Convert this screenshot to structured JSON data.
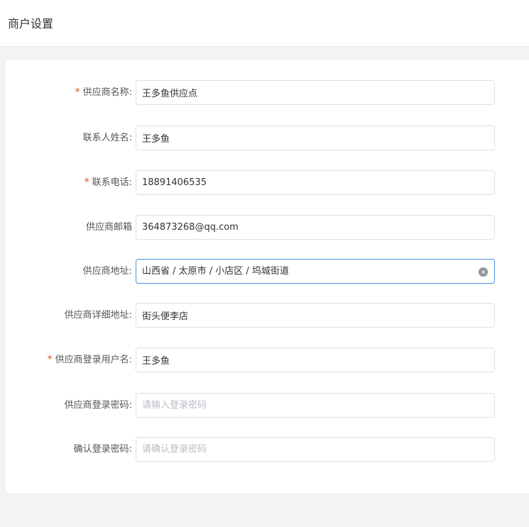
{
  "header": {
    "title": "商户设置"
  },
  "form": {
    "supplier_name": {
      "label": "供应商名称:",
      "required": true,
      "value": "王多鱼供应点"
    },
    "contact_name": {
      "label": "联系人姓名:",
      "required": false,
      "value": "王多鱼"
    },
    "contact_phone": {
      "label": "联系电话:",
      "required": true,
      "value": "18891406535"
    },
    "supplier_email": {
      "label": "供应商邮箱",
      "required": false,
      "value": "364873268@qq.com"
    },
    "supplier_address": {
      "label": "供应商地址:",
      "required": false,
      "value": "山西省 / 太原市 / 小店区 / 坞城街道",
      "clear_icon": "circle-close-icon"
    },
    "supplier_detail_address": {
      "label": "供应商详细地址:",
      "required": false,
      "value": "街头便李店"
    },
    "login_username": {
      "label": "供应商登录用户名:",
      "required": true,
      "value": "王多鱼"
    },
    "login_password": {
      "label": "供应商登录密码:",
      "required": false,
      "value": "",
      "placeholder": "请输入登录密码"
    },
    "confirm_password": {
      "label": "确认登录密码:",
      "required": false,
      "value": "",
      "placeholder": "请确认登录密码"
    },
    "required_mark": "*"
  },
  "colors": {
    "required": "#d9531e",
    "focus_border": "#4a90e2",
    "border": "#dcdfe6",
    "page_bg": "#f2f3f5"
  }
}
